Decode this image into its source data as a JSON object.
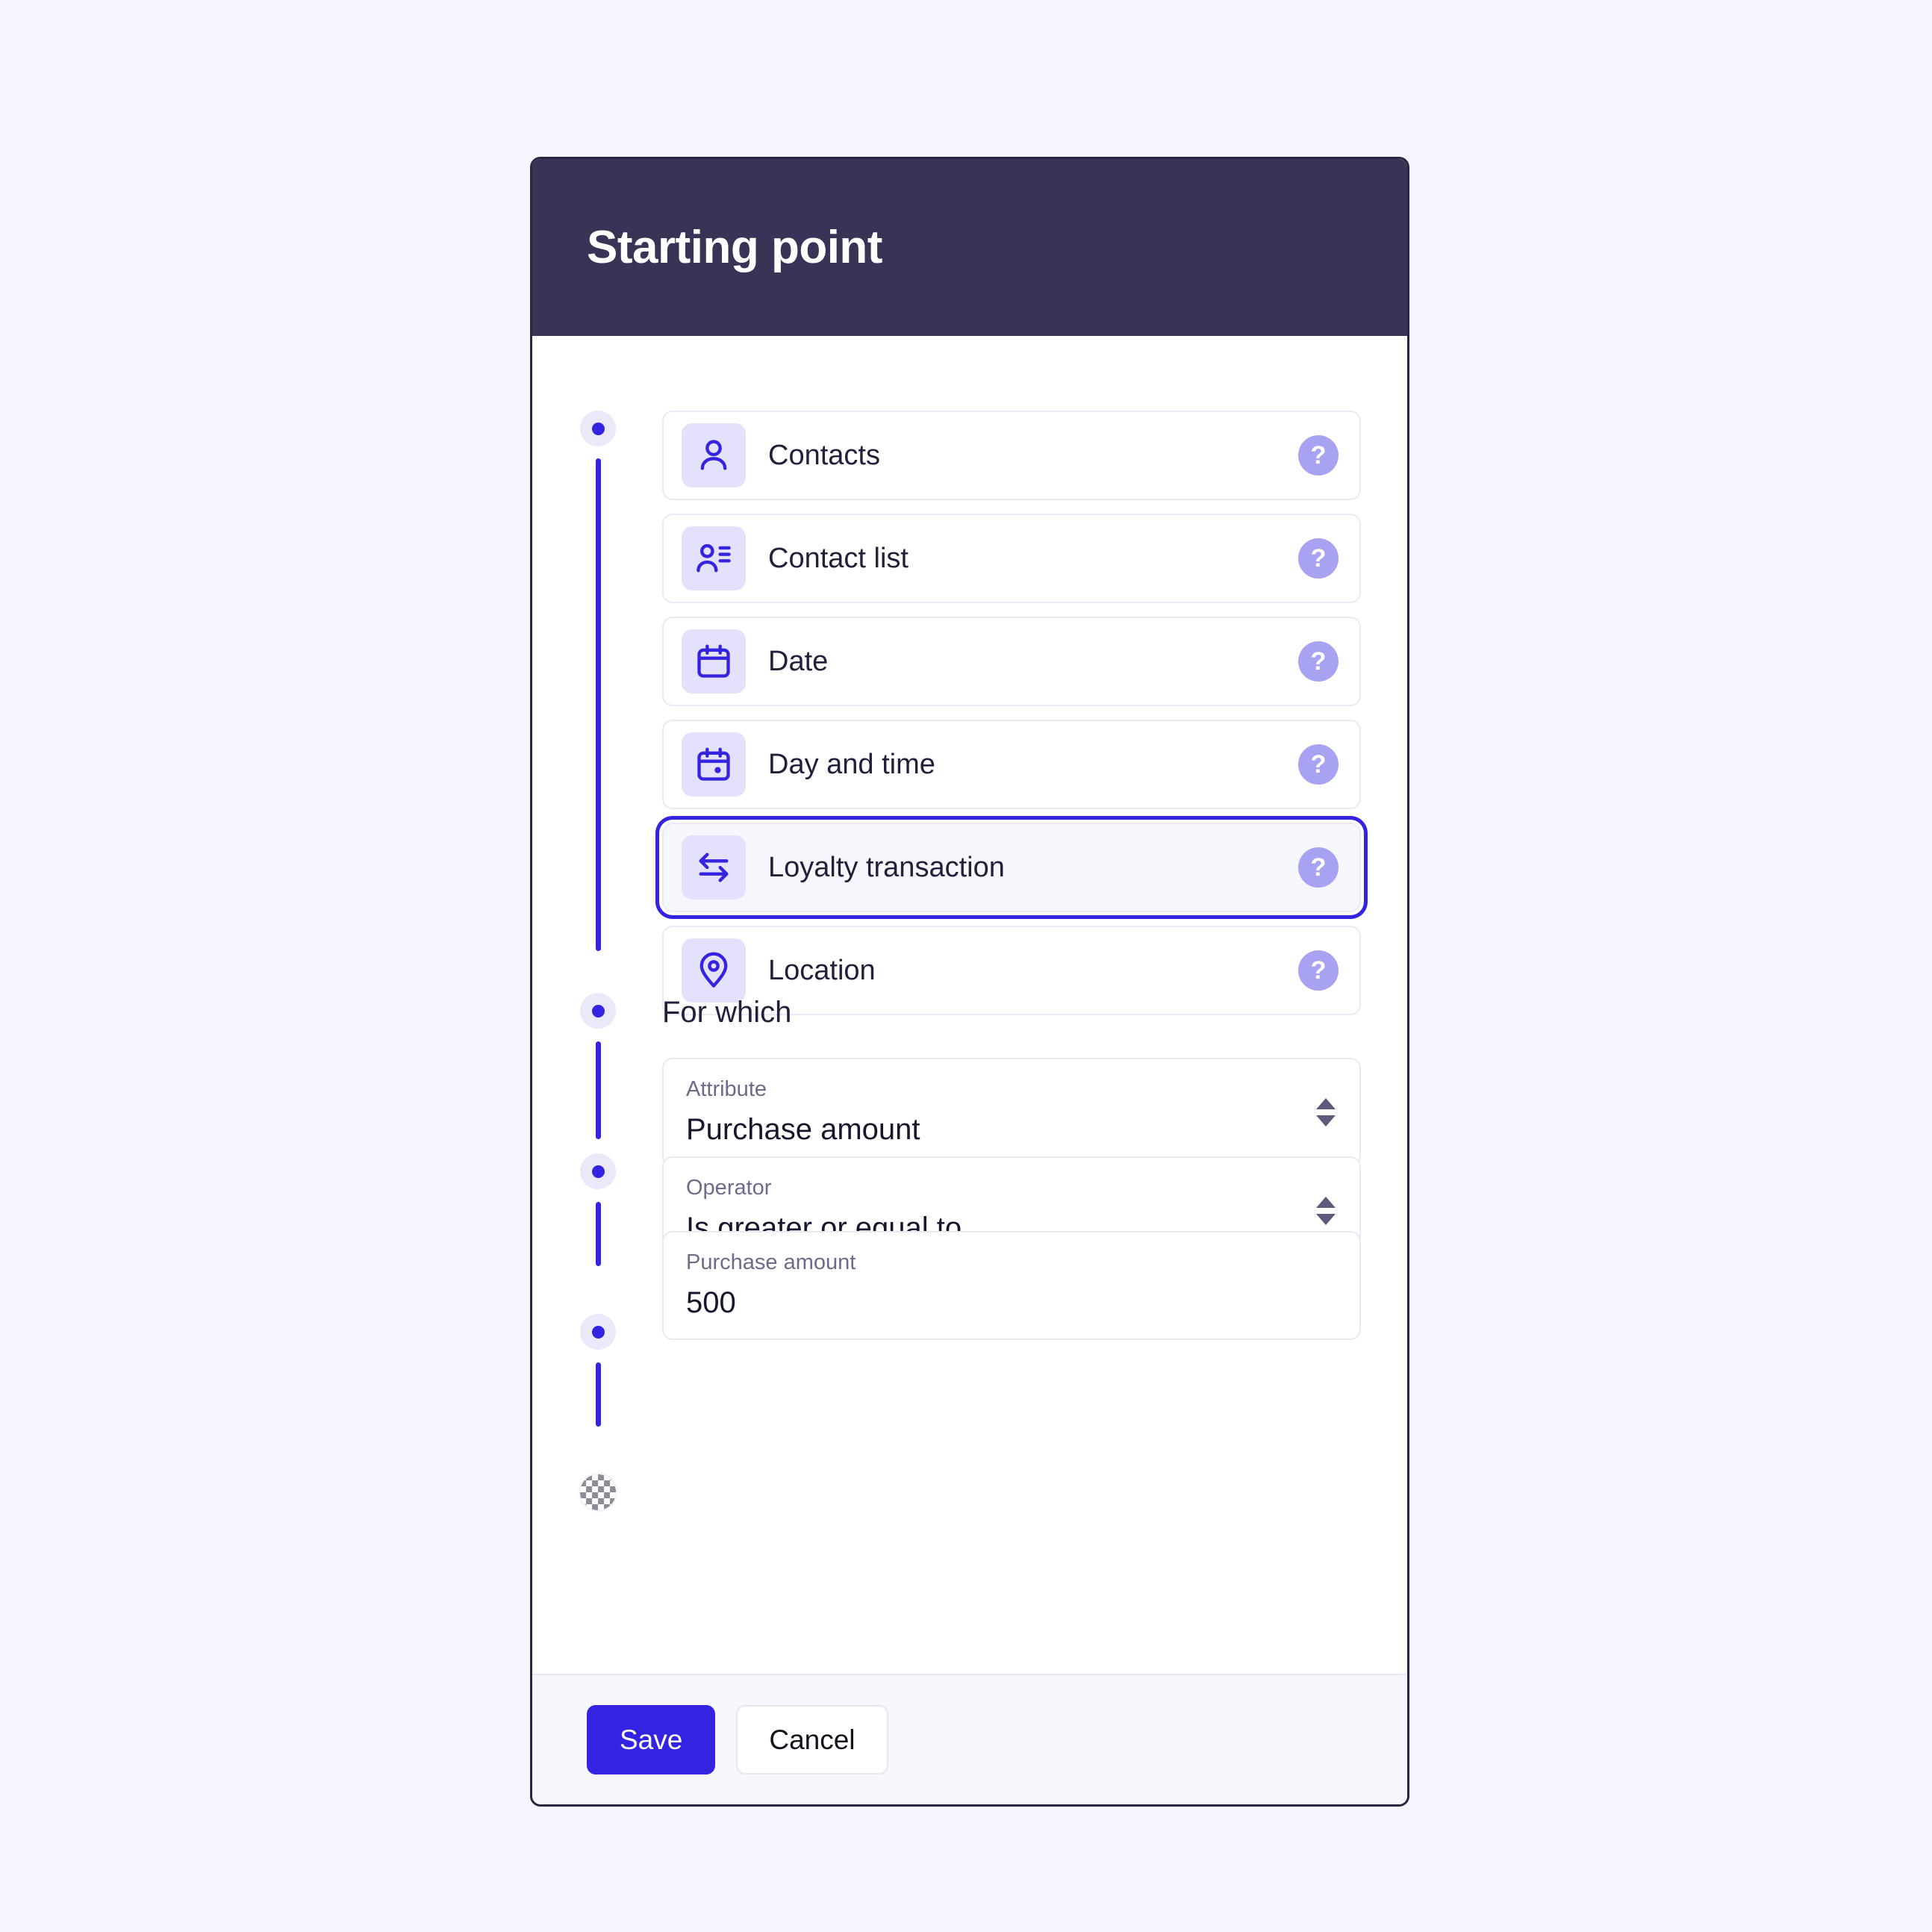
{
  "page": {
    "background_color": "#f5f5fd"
  },
  "dialog": {
    "title": "Starting point",
    "header_color": "#373455",
    "border_color": "#2a2540"
  },
  "options": {
    "items": [
      {
        "label": "Contacts",
        "icon": "user-icon",
        "help": "?",
        "selected": false
      },
      {
        "label": "Contact list",
        "icon": "contact-list-icon",
        "help": "?",
        "selected": false
      },
      {
        "label": "Date",
        "icon": "calendar-icon",
        "help": "?",
        "selected": false
      },
      {
        "label": "Day and time",
        "icon": "calendar-clock-icon",
        "help": "?",
        "selected": false
      },
      {
        "label": "Loyalty transaction",
        "icon": "transfer-arrows-icon",
        "help": "?",
        "selected": true
      },
      {
        "label": "Location",
        "icon": "map-pin-icon",
        "help": "?",
        "selected": false
      }
    ],
    "accent_color": "#3423e0",
    "icon_tile_color": "#e3e1fb",
    "help_badge_color": "#a8a2f2"
  },
  "for_which": {
    "heading": "For which",
    "fields": [
      {
        "label": "Attribute",
        "value": "Purchase amount",
        "control": "select"
      },
      {
        "label": "Operator",
        "value": "Is greater or equal to",
        "control": "select"
      },
      {
        "label": "Purchase amount",
        "value": "500",
        "control": "text"
      }
    ]
  },
  "footer": {
    "save_label": "Save",
    "cancel_label": "Cancel",
    "save_color": "#3423e0"
  }
}
